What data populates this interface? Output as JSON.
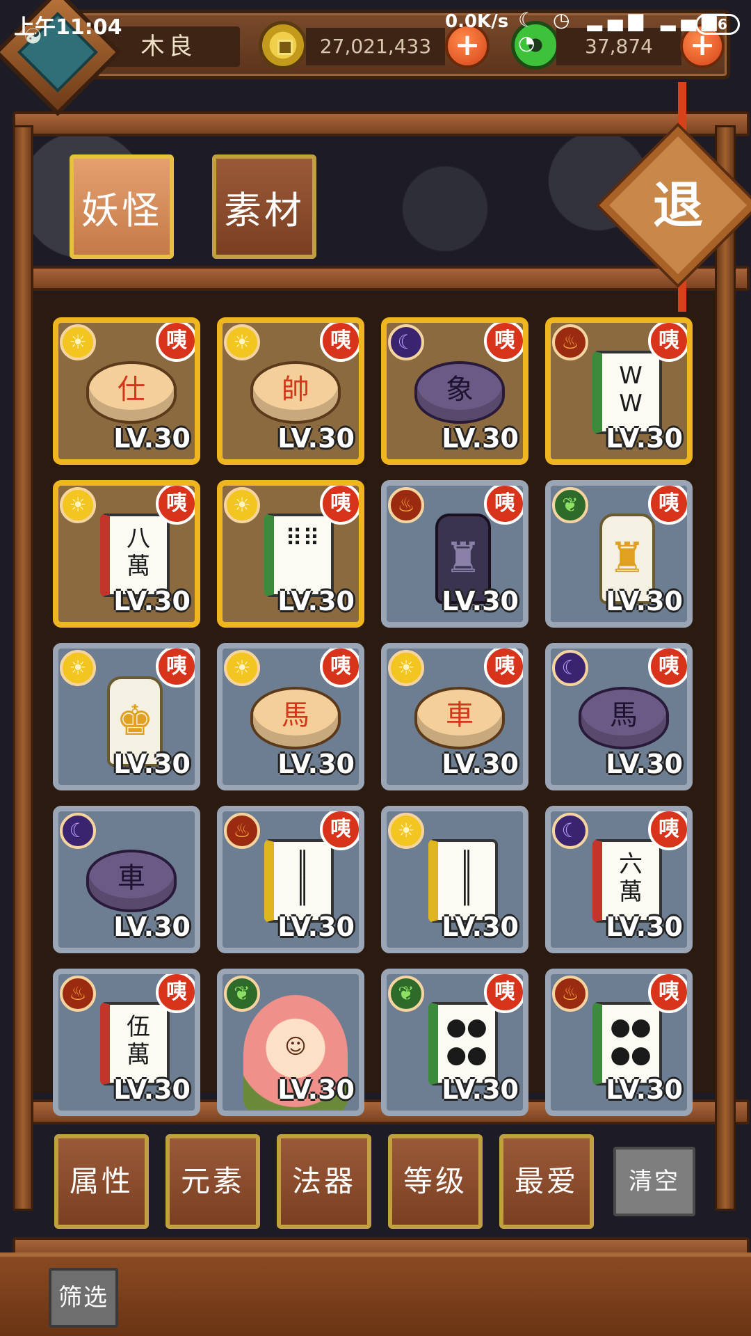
{
  "status_bar": {
    "time": "上午11:04",
    "network": "0.0K/s",
    "icons": "☾ ◷ ▂▄▆ ▂▄▆ ◔",
    "battery": "56"
  },
  "player": {
    "name": "木良",
    "gold": "27,021,433",
    "jade": "37,874",
    "avatar_icon": "taiji-bronze-avatar-icon"
  },
  "tabs": [
    {
      "label": "妖怪",
      "active": true
    },
    {
      "label": "素材",
      "active": false
    }
  ],
  "exit_label": "退",
  "cards": [
    {
      "rarity": "gold",
      "element": "sun",
      "piece": "disc-cream",
      "glyph": "仕",
      "tag": "咦",
      "level": "LV.30"
    },
    {
      "rarity": "gold",
      "element": "sun",
      "piece": "disc-cream",
      "glyph": "帥",
      "tag": "咦",
      "level": "LV.30"
    },
    {
      "rarity": "gold",
      "element": "moon",
      "piece": "disc-purple",
      "glyph": "象",
      "tag": "咦",
      "level": "LV.30"
    },
    {
      "rarity": "gold",
      "element": "fire",
      "piece": "tile-green",
      "glyph": "W\nW",
      "tag": "咦",
      "level": "LV.30"
    },
    {
      "rarity": "gold",
      "element": "sun",
      "piece": "tile-red",
      "glyph": "八\n萬",
      "tag": "咦",
      "level": "LV.30"
    },
    {
      "rarity": "gold",
      "element": "sun",
      "piece": "tile-green",
      "glyph": "⠿⠿",
      "tag": "咦",
      "level": "LV.30"
    },
    {
      "rarity": "grey",
      "element": "fire",
      "piece": "chess-dark",
      "glyph": "♜",
      "tag": "咦",
      "level": "LV.30"
    },
    {
      "rarity": "grey",
      "element": "leaf",
      "piece": "chess-light",
      "glyph": "♜",
      "tag": "咦",
      "level": "LV.30"
    },
    {
      "rarity": "grey",
      "element": "sun",
      "piece": "chess-light",
      "glyph": "♚",
      "tag": "咦",
      "level": "LV.30"
    },
    {
      "rarity": "grey",
      "element": "sun",
      "piece": "disc-cream",
      "glyph": "馬",
      "tag": "咦",
      "level": "LV.30"
    },
    {
      "rarity": "grey",
      "element": "sun",
      "piece": "disc-cream",
      "glyph": "車",
      "tag": "咦",
      "level": "LV.30"
    },
    {
      "rarity": "grey",
      "element": "moon",
      "piece": "disc-purple",
      "glyph": "馬",
      "tag": "咦",
      "level": "LV.30"
    },
    {
      "rarity": "grey",
      "element": "moon",
      "piece": "disc-purple",
      "glyph": "車",
      "tag": "",
      "level": "LV.30"
    },
    {
      "rarity": "grey",
      "element": "fire",
      "piece": "tile-yellow",
      "glyph": "║\n║",
      "tag": "咦",
      "level": "LV.30"
    },
    {
      "rarity": "grey",
      "element": "sun",
      "piece": "tile-yellow",
      "glyph": "║\n║",
      "tag": "",
      "level": "LV.30"
    },
    {
      "rarity": "grey",
      "element": "moon",
      "piece": "tile-red",
      "glyph": "六\n萬",
      "tag": "咦",
      "level": "LV.30"
    },
    {
      "rarity": "grey",
      "element": "fire",
      "piece": "tile-red",
      "glyph": "伍\n萬",
      "tag": "咦",
      "level": "LV.30"
    },
    {
      "rarity": "grey",
      "element": "leaf",
      "piece": "girl",
      "glyph": "☺",
      "tag": "",
      "level": "LV.30"
    },
    {
      "rarity": "grey",
      "element": "leaf",
      "piece": "tile-green",
      "glyph": "●●\n●●",
      "tag": "咦",
      "level": "LV.30"
    },
    {
      "rarity": "grey",
      "element": "fire",
      "piece": "tile-green",
      "glyph": "●●\n●●",
      "tag": "咦",
      "level": "LV.30"
    }
  ],
  "filter_buttons": [
    "属性",
    "元素",
    "法器",
    "等级",
    "最爱"
  ],
  "clear_label": "清空",
  "screen_label": "筛选"
}
